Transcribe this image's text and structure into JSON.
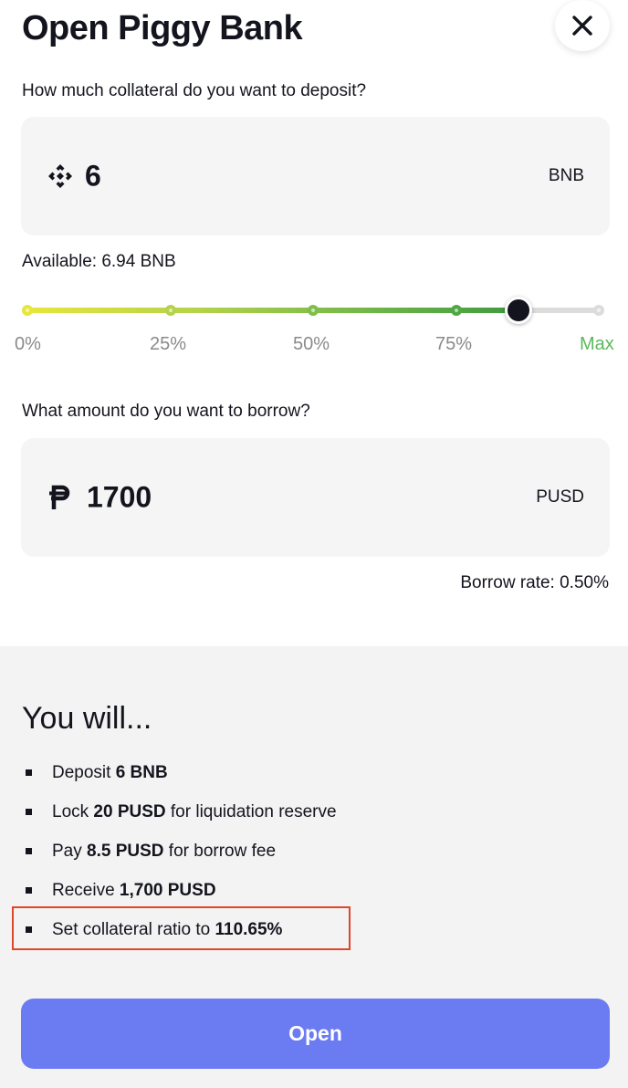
{
  "header": {
    "title": "Open Piggy Bank",
    "close_icon": "close-icon"
  },
  "deposit": {
    "question": "How much collateral do you want to deposit?",
    "icon": "bnb-icon",
    "amount": "6",
    "unit": "BNB",
    "available": "Available: 6.94 BNB"
  },
  "slider": {
    "value_percent": 86,
    "ticks": [
      "0%",
      "25%",
      "50%",
      "75%",
      "Max"
    ],
    "max_color": "#5cb85c",
    "tick_color": "#8a8a8a"
  },
  "borrow": {
    "question": "What amount do you want to borrow?",
    "icon": "pusd-icon",
    "amount": "1700",
    "unit": "PUSD",
    "rate": "Borrow rate: 0.50%"
  },
  "summary": {
    "title": "You will...",
    "items": [
      {
        "pre": "Deposit ",
        "bold": "6 BNB",
        "post": ""
      },
      {
        "pre": "Lock ",
        "bold": "20 PUSD",
        "post": " for liquidation reserve"
      },
      {
        "pre": "Pay ",
        "bold": "8.5 PUSD",
        "post": " for borrow fee"
      },
      {
        "pre": "Receive ",
        "bold": "1,700 PUSD",
        "post": ""
      },
      {
        "pre": "Set collateral ratio to ",
        "bold": "110.65%",
        "post": ""
      }
    ]
  },
  "actions": {
    "open_label": "Open",
    "button_color": "#6b7bf2"
  },
  "annotation_color": "#e0462b"
}
